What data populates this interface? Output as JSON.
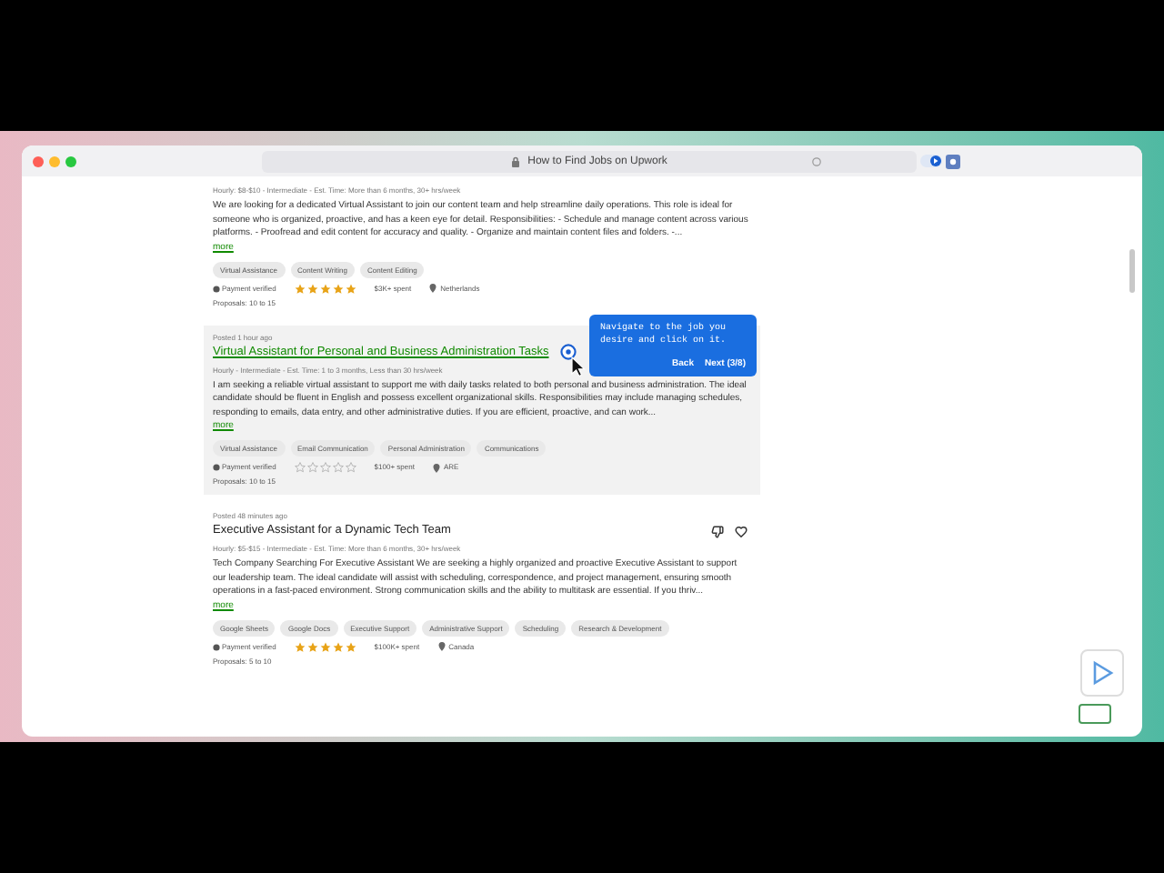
{
  "browser": {
    "title": "How to Find Jobs on Upwork"
  },
  "jobs": [
    {
      "meta": "Hourly: $8-$10 - Intermediate - Est. Time: More than 6 months, 30+ hrs/week",
      "description": "We are looking for a dedicated Virtual Assistant to join our content team and help streamline daily operations. This role is ideal for someone who is organized, proactive, and has a keen eye for detail. Responsibilities: - Schedule and manage content across various platforms. - Proofread and edit content for accuracy and quality. - Organize and maintain content files and folders. -...",
      "more": "more",
      "tags": [
        "Virtual Assistance",
        "Content Writing",
        "Content Editing"
      ],
      "payment": "Payment verified",
      "stars": 5,
      "spent": "$3K+ spent",
      "location": "Netherlands",
      "proposals": "Proposals: 10 to 15",
      "selected": false,
      "show_actions": false
    },
    {
      "posted": "Posted 1 hour ago",
      "title": "Virtual Assistant for Personal and Business Administration Tasks",
      "meta": "Hourly - Intermediate - Est. Time: 1 to 3 months, Less than 30 hrs/week",
      "description": "I am seeking a reliable virtual assistant to support me with daily tasks related to both personal and business administration. The ideal candidate should be fluent in English and possess excellent organizational skills. Responsibilities may include managing schedules, responding to emails, data entry, and other administrative duties. If you are efficient, proactive, and can work...",
      "more": "more",
      "tags": [
        "Virtual Assistance",
        "Email Communication",
        "Personal Administration",
        "Communications"
      ],
      "payment": "Payment verified",
      "stars": 0,
      "spent": "$100+ spent",
      "location": "ARE",
      "proposals": "Proposals: 10 to 15",
      "selected": true,
      "show_actions": false
    },
    {
      "posted": "Posted 48 minutes ago",
      "title": "Executive Assistant for a Dynamic Tech Team",
      "meta": "Hourly: $5-$15 - Intermediate - Est. Time: More than 6 months, 30+ hrs/week",
      "description": "Tech Company Searching For Executive Assistant We are seeking a highly organized and proactive Executive Assistant to support our leadership team. The ideal candidate will assist with scheduling, correspondence, and project management, ensuring smooth operations in a fast-paced environment. Strong communication skills and the ability to multitask are essential. If you thriv...",
      "more": "more",
      "tags": [
        "Google Sheets",
        "Google Docs",
        "Executive Support",
        "Administrative Support",
        "Scheduling",
        "Research & Development"
      ],
      "payment": "Payment verified",
      "stars": 5,
      "spent": "$100K+ spent",
      "location": "Canada",
      "proposals": "Proposals: 5 to 10",
      "selected": false,
      "show_actions": true
    }
  ],
  "tooltip": {
    "text": "Navigate to the job you desire and click on it.",
    "back": "Back",
    "next": "Next (3/8)"
  }
}
